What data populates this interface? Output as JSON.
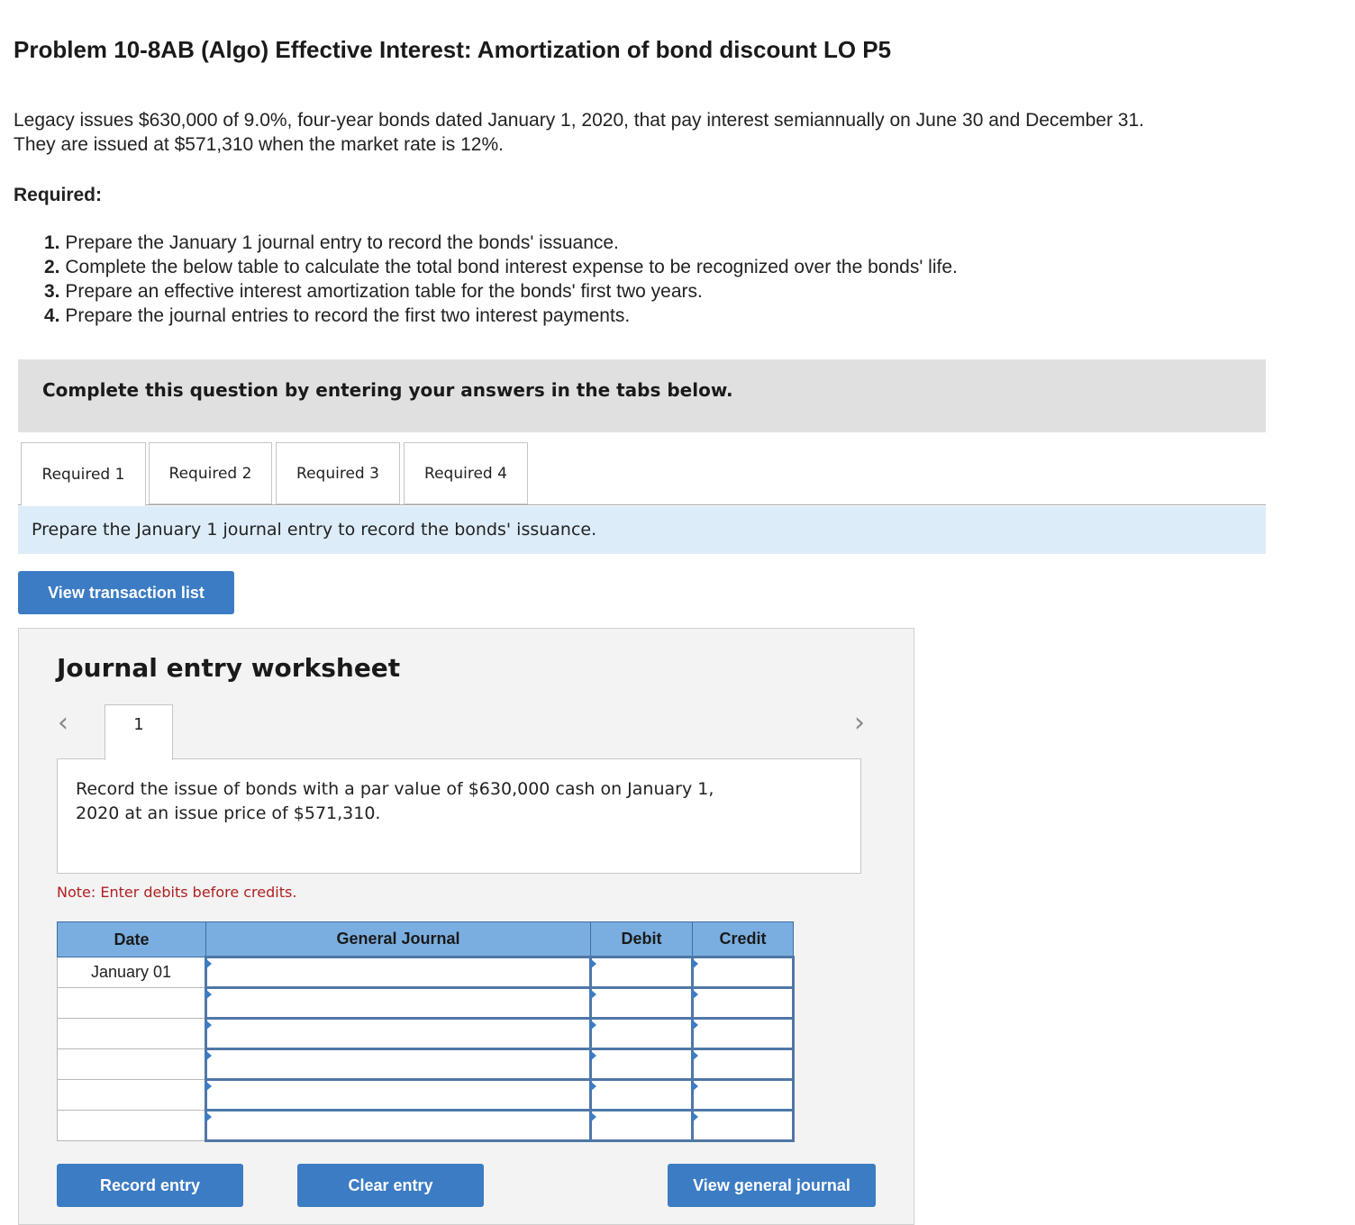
{
  "problem": {
    "title": "Problem 10-8AB (Algo) Effective Interest: Amortization of bond discount LO P5",
    "intro_line1": "Legacy issues $630,000 of 9.0%, four-year bonds dated January 1, 2020, that pay interest semiannually on June 30 and December 31.",
    "intro_line2": "They are issued at $571,310 when the market rate is 12%.",
    "required_heading": "Required:",
    "requirements": [
      {
        "num": "1.",
        "text": "Prepare the January 1 journal entry to record the bonds' issuance."
      },
      {
        "num": "2.",
        "text": "Complete the below table to calculate the total bond interest expense to be recognized over the bonds' life."
      },
      {
        "num": "3.",
        "text": "Prepare an effective interest amortization table for the bonds' first two years."
      },
      {
        "num": "4.",
        "text": "Prepare the journal entries to record the first two interest payments."
      }
    ]
  },
  "instruction": "Complete this question by entering your answers in the tabs below.",
  "tabs": [
    {
      "label": "Required 1",
      "active": true
    },
    {
      "label": "Required 2",
      "active": false
    },
    {
      "label": "Required 3",
      "active": false
    },
    {
      "label": "Required 4",
      "active": false
    }
  ],
  "tab_prompt": "Prepare the January 1 journal entry to record the bonds' issuance.",
  "view_transaction_label": "View transaction list",
  "worksheet": {
    "title": "Journal entry worksheet",
    "current_page": "1",
    "description": "Record the issue of bonds with a par value of $630,000 cash on January 1, 2020 at an issue price of $571,310.",
    "note": "Note: Enter debits before credits.",
    "columns": {
      "date": "Date",
      "general_journal": "General Journal",
      "debit": "Debit",
      "credit": "Credit"
    },
    "rows": [
      {
        "date": "January 01",
        "account": "",
        "debit": "",
        "credit": ""
      },
      {
        "date": "",
        "account": "",
        "debit": "",
        "credit": ""
      },
      {
        "date": "",
        "account": "",
        "debit": "",
        "credit": ""
      },
      {
        "date": "",
        "account": "",
        "debit": "",
        "credit": ""
      },
      {
        "date": "",
        "account": "",
        "debit": "",
        "credit": ""
      },
      {
        "date": "",
        "account": "",
        "debit": "",
        "credit": ""
      }
    ],
    "record_label": "Record entry",
    "clear_label": "Clear entry",
    "view_journal_label": "View general journal"
  },
  "colors": {
    "button": "#3c7cc4",
    "table_header": "#7aaee0",
    "prompt_bg": "#dcecf9",
    "note_text": "#b02020"
  }
}
